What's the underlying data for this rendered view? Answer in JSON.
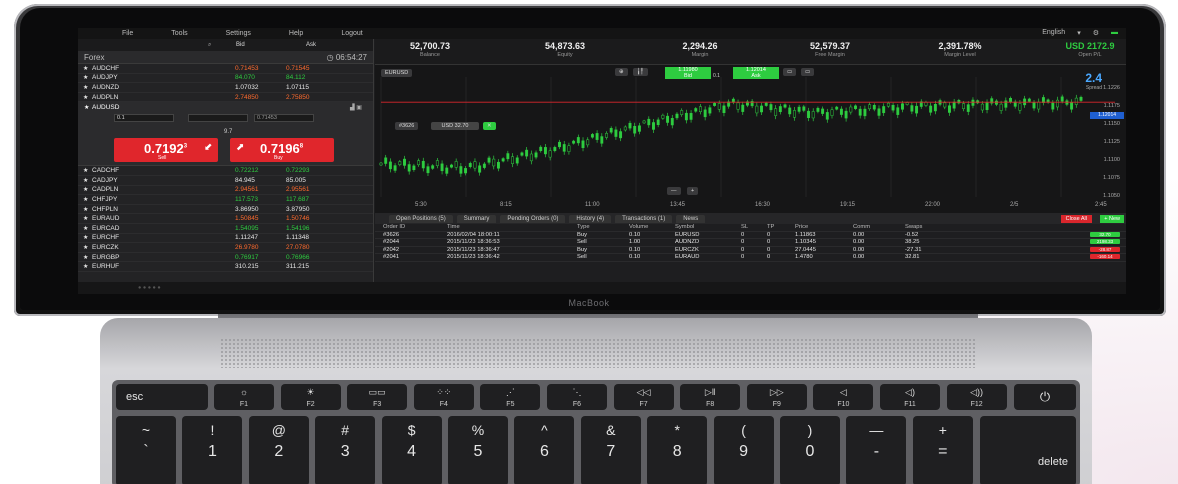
{
  "menu": {
    "items": [
      "File",
      "Tools",
      "Settings",
      "Help",
      "Logout"
    ],
    "language": "English"
  },
  "watchlist": {
    "bid_header": "Bid",
    "ask_header": "Ask",
    "category": "Forex",
    "clock": "06:54:27",
    "rows_top": [
      {
        "symbol": "AUDCHF",
        "bid": "0.71453",
        "ask": "0.71545"
      },
      {
        "symbol": "AUDJPY",
        "bid": "84.070",
        "ask": "84.112"
      },
      {
        "symbol": "AUDNZD",
        "bid": "1.07032",
        "ask": "1.07115"
      },
      {
        "symbol": "AUDPLN",
        "bid": "2.74850",
        "ask": "2.75850"
      }
    ],
    "ticket": {
      "symbol": "AUDUSD",
      "amount": "0.1",
      "spread": "9.7",
      "sell_price": "0.7192",
      "sell_sup": "3",
      "sell_label": "Sell",
      "buy_price": "0.7196",
      "buy_sup": "8",
      "buy_label": "Buy"
    },
    "rows_bottom": [
      {
        "symbol": "CADCHF",
        "bid": "0.72212",
        "ask": "0.72293"
      },
      {
        "symbol": "CADJPY",
        "bid": "84.945",
        "ask": "85.005"
      },
      {
        "symbol": "CADPLN",
        "bid": "2.94561",
        "ask": "2.95561"
      },
      {
        "symbol": "CHFJPY",
        "bid": "117.573",
        "ask": "117.687"
      },
      {
        "symbol": "CHFPLN",
        "bid": "3.86950",
        "ask": "3.87950"
      },
      {
        "symbol": "EURAUD",
        "bid": "1.50845",
        "ask": "1.50746"
      },
      {
        "symbol": "EURCAD",
        "bid": "1.54095",
        "ask": "1.54196"
      },
      {
        "symbol": "EURCHF",
        "bid": "1.11247",
        "ask": "1.11348"
      },
      {
        "symbol": "EURCZK",
        "bid": "26.9780",
        "ask": "27.0780"
      },
      {
        "symbol": "EURGBP",
        "bid": "0.76917",
        "ask": "0.76966"
      },
      {
        "symbol": "EURHUF",
        "bid": "310.215",
        "ask": "311.215"
      }
    ]
  },
  "account": [
    {
      "value": "52,700.73",
      "label": "Balance"
    },
    {
      "value": "54,873.63",
      "label": "Equity"
    },
    {
      "value": "2,294.26",
      "label": "Margin"
    },
    {
      "value": "52,579.37",
      "label": "Free Margin"
    },
    {
      "value": "2,391.78%",
      "label": "Margin Level"
    },
    {
      "value": "USD 2172.9",
      "label": "Open P/L"
    }
  ],
  "chart": {
    "symbol": "EURUSD",
    "bid": "1.11980",
    "ask": "1.12014",
    "bid_label": "Bid",
    "ask_label": "Ask",
    "lot": "0.1",
    "spread": "2.4",
    "spread_label": "Spread",
    "position_id": "#3626",
    "position_label": "USD 32.70",
    "price_tag": "1.12014",
    "x_labels": [
      "5:30",
      "8:15",
      "11:00",
      "13:45",
      "16:30",
      "19:15",
      "22:00",
      "2/5",
      "2:45"
    ],
    "y_labels": [
      "1.1226",
      "1.1175",
      "1.1150",
      "1.1125",
      "1.1100",
      "1.1075",
      "1.1050"
    ]
  },
  "chart_data": {
    "type": "line",
    "title": "EURUSD",
    "x": [
      "5:30",
      "8:15",
      "11:00",
      "13:45",
      "16:30",
      "19:15",
      "22:00",
      "2/5",
      "2:45"
    ],
    "series": [
      {
        "values": [
          1.1095,
          1.1088,
          1.112,
          1.116,
          1.1195,
          1.118,
          1.119,
          1.1195,
          1.1198
        ]
      }
    ],
    "ylim": [
      1.104,
      1.124
    ]
  },
  "bottom": {
    "tabs": [
      "Open Positions (5)",
      "Summary",
      "Pending Orders (0)",
      "History (4)",
      "Transactions (1)",
      "News"
    ],
    "close_all": "Close All",
    "new": "+ New",
    "columns": [
      "Order ID",
      "Time",
      "Type",
      "Volume",
      "Symbol",
      "SL",
      "TP",
      "Price",
      "Comm",
      "Swaps"
    ],
    "rows": [
      [
        "#3626",
        "2016/02/04 18:00:11",
        "Buy",
        "0.10",
        "EURUSD",
        "0",
        "0",
        "1.11863",
        "0.00",
        "-0.52"
      ],
      [
        "#2044",
        "2015/11/23 18:36:53",
        "Sell",
        "1.00",
        "AUDNZD",
        "0",
        "0",
        "1.10345",
        "0.00",
        "38.25"
      ],
      [
        "#2042",
        "2015/11/23 18:36:47",
        "Buy",
        "0.10",
        "EURCZK",
        "0",
        "0",
        "27.0445",
        "0.00",
        "-27.31"
      ],
      [
        "#2041",
        "2015/11/23 18:36:42",
        "Sell",
        "0.10",
        "EURAUD",
        "0",
        "0",
        "1.4780",
        "0.00",
        "32.81"
      ]
    ],
    "pl": [
      "32.70",
      "2198.33",
      "-28.87",
      "-160.14"
    ]
  },
  "brand": "MacBook",
  "keyboard": {
    "fkeys": [
      {
        "icon": "☼",
        "label": "F1"
      },
      {
        "icon": "☀",
        "label": "F2"
      },
      {
        "icon": "▭▭",
        "label": "F3"
      },
      {
        "icon": "⁘⁘",
        "label": "F4"
      },
      {
        "icon": "⋰",
        "label": "F5"
      },
      {
        "icon": "⋱",
        "label": "F6"
      },
      {
        "icon": "◁◁",
        "label": "F7"
      },
      {
        "icon": "▷‖",
        "label": "F8"
      },
      {
        "icon": "▷▷",
        "label": "F9"
      },
      {
        "icon": "◁",
        "label": "F10"
      },
      {
        "icon": "◁)",
        "label": "F11"
      },
      {
        "icon": "◁))",
        "label": "F12"
      }
    ],
    "esc": "esc",
    "power": "⏻",
    "numkeys": [
      {
        "top": "~",
        "bottom": "`"
      },
      {
        "top": "!",
        "bottom": "1"
      },
      {
        "top": "@",
        "bottom": "2"
      },
      {
        "top": "#",
        "bottom": "3"
      },
      {
        "top": "$",
        "bottom": "4"
      },
      {
        "top": "%",
        "bottom": "5"
      },
      {
        "top": "^",
        "bottom": "6"
      },
      {
        "top": "&",
        "bottom": "7"
      },
      {
        "top": "*",
        "bottom": "8"
      },
      {
        "top": "(",
        "bottom": "9"
      },
      {
        "top": ")",
        "bottom": "0"
      },
      {
        "top": "—",
        "bottom": "-"
      },
      {
        "top": "+",
        "bottom": "="
      }
    ],
    "delete": "delete"
  }
}
